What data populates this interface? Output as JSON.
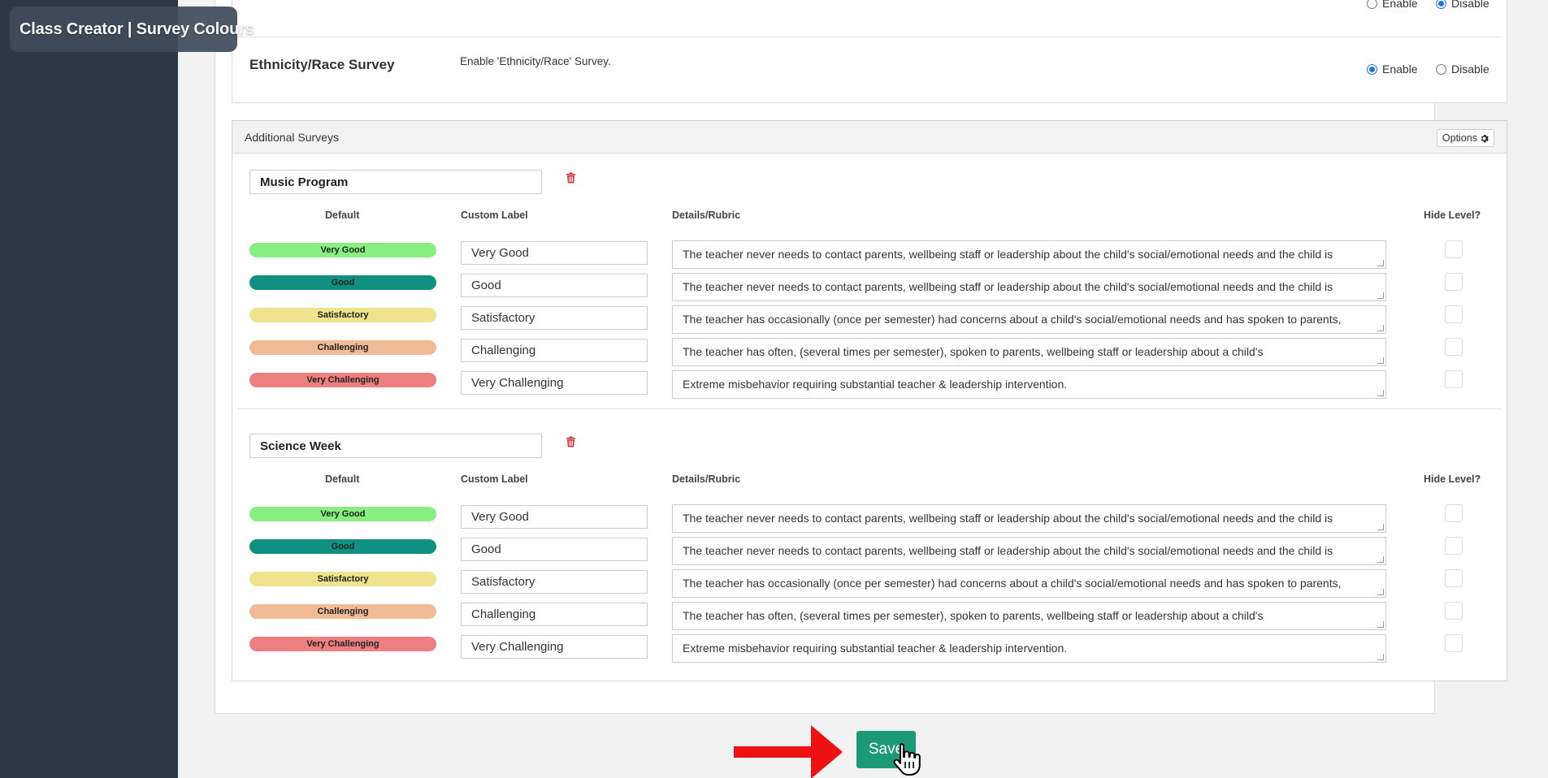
{
  "app": {
    "title": "Class Creator | Survey Colours"
  },
  "settings": {
    "top_row": {
      "enable_label": "Enable",
      "disable_label": "Disable",
      "selected": "Disable"
    },
    "ethnicity": {
      "title": "Ethnicity/Race Survey",
      "description": "Enable 'Ethnicity/Race' Survey.",
      "enable_label": "Enable",
      "disable_label": "Disable",
      "selected": "Enable"
    }
  },
  "additional_surveys": {
    "header": "Additional Surveys",
    "options_label": "Options",
    "columns": {
      "default": "Default",
      "custom_label": "Custom Label",
      "details": "Details/Rubric",
      "hide": "Hide Level?"
    },
    "surveys": [
      {
        "name": "Music Program",
        "levels": [
          {
            "default": "Very Good",
            "color": "#86ef7f",
            "custom_label": "Very Good",
            "details": "The teacher never needs to contact parents, wellbeing staff or leadership about the child's social/emotional needs and the child is",
            "hidden": false
          },
          {
            "default": "Good",
            "color": "#0f9080",
            "custom_label": "Good",
            "details": "The teacher never needs to contact parents, wellbeing staff or leadership about the child's social/emotional needs and the child is",
            "hidden": false
          },
          {
            "default": "Satisfactory",
            "color": "#f0e38e",
            "custom_label": "Satisfactory",
            "details": "The teacher has occasionally (once per semester) had concerns about a child's social/emotional needs and has spoken to parents,",
            "hidden": false
          },
          {
            "default": "Challenging",
            "color": "#f1bb95",
            "custom_label": "Challenging",
            "details": "The teacher has often, (several times per semester), spoken to parents, wellbeing staff or leadership about a child's",
            "hidden": false
          },
          {
            "default": "Very Challenging",
            "color": "#ee7f80",
            "custom_label": "Very Challenging",
            "details": "Extreme misbehavior requiring substantial teacher & leadership intervention.",
            "hidden": false
          }
        ]
      },
      {
        "name": "Science Week",
        "levels": [
          {
            "default": "Very Good",
            "color": "#86ef7f",
            "custom_label": "Very Good",
            "details": "The teacher never needs to contact parents, wellbeing staff or leadership about the child's social/emotional needs and the child is",
            "hidden": false
          },
          {
            "default": "Good",
            "color": "#0f9080",
            "custom_label": "Good",
            "details": "The teacher never needs to contact parents, wellbeing staff or leadership about the child's social/emotional needs and the child is",
            "hidden": false
          },
          {
            "default": "Satisfactory",
            "color": "#f0e38e",
            "custom_label": "Satisfactory",
            "details": "The teacher has occasionally (once per semester) had concerns about a child's social/emotional needs and has spoken to parents,",
            "hidden": false
          },
          {
            "default": "Challenging",
            "color": "#f1bb95",
            "custom_label": "Challenging",
            "details": "The teacher has often, (several times per semester), spoken to parents, wellbeing staff or leadership about a child's",
            "hidden": false
          },
          {
            "default": "Very Challenging",
            "color": "#ee7f80",
            "custom_label": "Very Challenging",
            "details": "Extreme misbehavior requiring substantial teacher & leadership intervention.",
            "hidden": false
          }
        ]
      }
    ]
  },
  "actions": {
    "save_label": "Save",
    "accent": "#1c9a78",
    "arrow_color": "#ee1111"
  }
}
